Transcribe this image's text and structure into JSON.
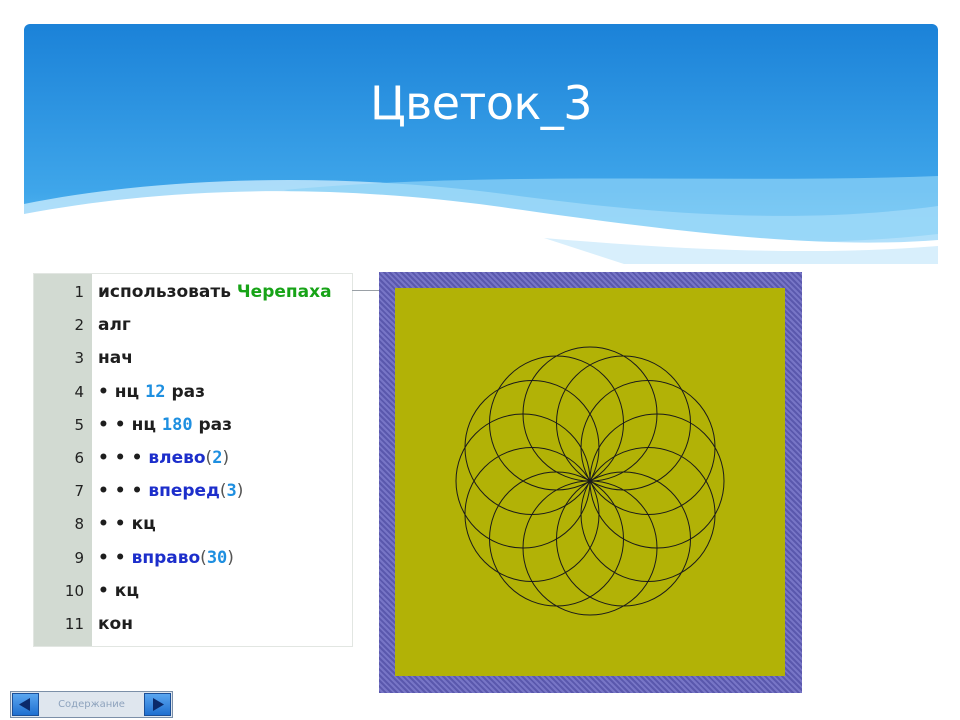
{
  "slide": {
    "title": "Цветок_3",
    "header_colors": {
      "top": "#1b82d8",
      "bottom": "#6cc7f7"
    }
  },
  "code_editor": {
    "lines": [
      {
        "number": "1",
        "dots": "",
        "tokens": [
          {
            "text": "использовать ",
            "kind": "kw"
          },
          {
            "text": "Черепаха",
            "kind": "mod"
          }
        ]
      },
      {
        "number": "2",
        "dots": "",
        "tokens": [
          {
            "text": "алг",
            "kind": "kw"
          }
        ]
      },
      {
        "number": "3",
        "dots": "",
        "tokens": [
          {
            "text": "нач",
            "kind": "kw"
          }
        ]
      },
      {
        "number": "4",
        "dots": "• ",
        "tokens": [
          {
            "text": "нц ",
            "kind": "kw"
          },
          {
            "text": "12",
            "kind": "num"
          },
          {
            "text": " раз",
            "kind": "kw"
          }
        ]
      },
      {
        "number": "5",
        "dots": "• • ",
        "tokens": [
          {
            "text": "нц ",
            "kind": "kw"
          },
          {
            "text": "180",
            "kind": "num"
          },
          {
            "text": " раз",
            "kind": "kw"
          }
        ]
      },
      {
        "number": "6",
        "dots": "• • • ",
        "tokens": [
          {
            "text": "влево",
            "kind": "fn"
          },
          {
            "text": "(",
            "kind": "paren"
          },
          {
            "text": "2",
            "kind": "num"
          },
          {
            "text": ")",
            "kind": "paren"
          }
        ]
      },
      {
        "number": "7",
        "dots": "• • • ",
        "tokens": [
          {
            "text": "вперед",
            "kind": "fn"
          },
          {
            "text": "(",
            "kind": "paren"
          },
          {
            "text": "3",
            "kind": "num"
          },
          {
            "text": ")",
            "kind": "paren"
          }
        ]
      },
      {
        "number": "8",
        "dots": "• • ",
        "tokens": [
          {
            "text": "кц",
            "kind": "kw"
          }
        ]
      },
      {
        "number": "9",
        "dots": "• • ",
        "tokens": [
          {
            "text": "вправо",
            "kind": "fn"
          },
          {
            "text": "(",
            "kind": "paren"
          },
          {
            "text": "30",
            "kind": "num"
          },
          {
            "text": ")",
            "kind": "paren"
          }
        ]
      },
      {
        "number": "10",
        "dots": "• ",
        "tokens": [
          {
            "text": "кц",
            "kind": "kw"
          }
        ]
      },
      {
        "number": "11",
        "dots": "",
        "tokens": [
          {
            "text": "кон",
            "kind": "kw"
          }
        ]
      }
    ]
  },
  "turtle_canvas": {
    "frame_color": "#5f5db3",
    "field_color": "#b2b206",
    "stroke_color": "#1a1a1a",
    "circle_count": 12
  },
  "nav": {
    "label": "Содержание",
    "prev_icon": "arrow-left-icon",
    "next_icon": "arrow-right-icon"
  }
}
